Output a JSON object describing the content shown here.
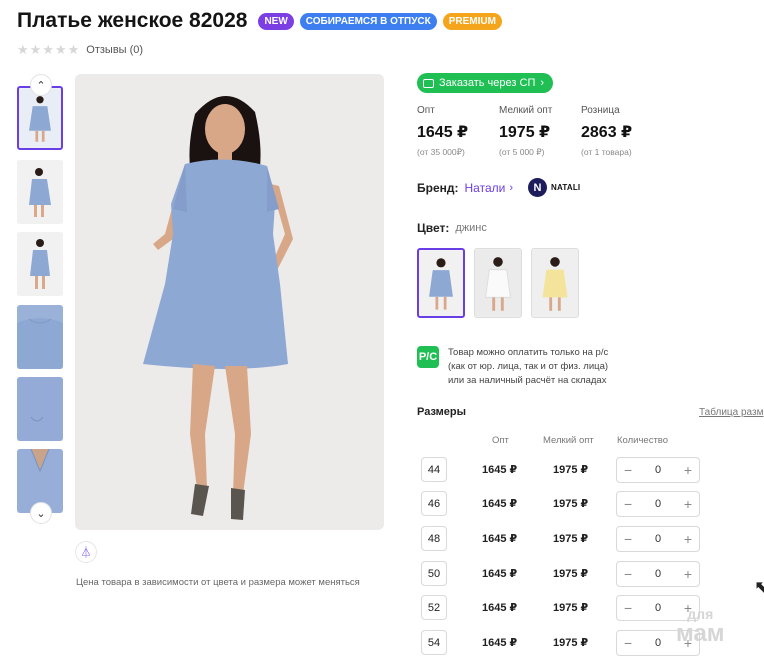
{
  "product": {
    "title": "Платье женское 82028",
    "badges": [
      "NEW",
      "СОБИРАЕМСЯ В ОТПУСК",
      "PREMIUM"
    ],
    "reviews": "Отзывы (0)"
  },
  "gallery": {
    "price_note": "Цена товара в зависимости от цвета и размера может меняться",
    "thumbnail_count": 6
  },
  "order_button": "Заказать через СП",
  "prices": [
    {
      "label": "Опт",
      "value": "1645 ₽",
      "sub": "(от 35 000₽)"
    },
    {
      "label": "Мелкий опт",
      "value": "1975 ₽",
      "sub": "(от 5 000 ₽)"
    },
    {
      "label": "Розница",
      "value": "2863 ₽",
      "sub": "(от 1 товара)"
    }
  ],
  "brand": {
    "label": "Бренд:",
    "name": "Натали",
    "logo_text": "NATALI"
  },
  "color": {
    "label": "Цвет:",
    "value": "джинс",
    "options": [
      "джинс",
      "белый",
      "желтый"
    ]
  },
  "payment": {
    "icon": "Р/С",
    "lines": [
      "Товар можно оплатить только на р/с",
      "(как от юр. лица, так и от физ. лица)",
      "или за наличный расчёт на складах"
    ]
  },
  "sizes": {
    "title": "Размеры",
    "table_link": "Таблица разм",
    "headers": [
      "Опт",
      "Мелкий опт",
      "Количество"
    ],
    "rows": [
      {
        "size": "44",
        "opt": "1645 ₽",
        "small": "1975 ₽",
        "qty": "0"
      },
      {
        "size": "46",
        "opt": "1645 ₽",
        "small": "1975 ₽",
        "qty": "0"
      },
      {
        "size": "48",
        "opt": "1645 ₽",
        "small": "1975 ₽",
        "qty": "0"
      },
      {
        "size": "50",
        "opt": "1645 ₽",
        "small": "1975 ₽",
        "qty": "0"
      },
      {
        "size": "52",
        "opt": "1645 ₽",
        "small": "1975 ₽",
        "qty": "0"
      },
      {
        "size": "54",
        "opt": "1645 ₽",
        "small": "1975 ₽",
        "qty": "0"
      }
    ]
  },
  "watermark": {
    "top": "для",
    "bottom": "мам"
  },
  "colors": {
    "accent": "#6a3ee6",
    "green": "#1fbf54",
    "dress": "#8ea8d4"
  }
}
